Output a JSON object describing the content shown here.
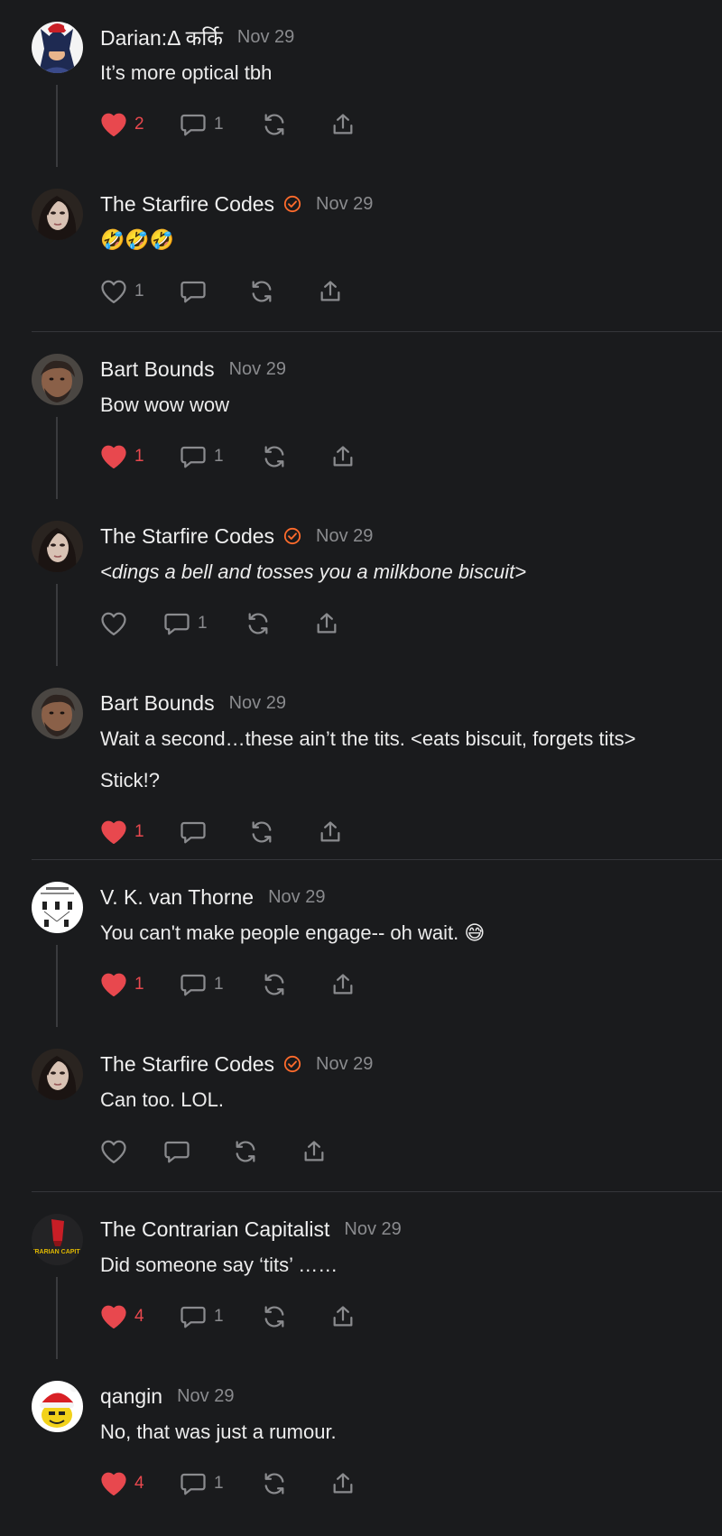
{
  "colors": {
    "background": "#1a1b1d",
    "liked": "#e8484e",
    "verified": "#ff6b2c",
    "muted": "#8a8b8e"
  },
  "comments": [
    {
      "author": "Darian:Δ कर्कि",
      "date": "Nov 29",
      "text": "It’s more optical tbh",
      "liked": true,
      "likes": "2",
      "replies": "1",
      "verified": false,
      "avatar": "batman-avatar"
    },
    {
      "author": "The Starfire Codes",
      "date": "Nov 29",
      "text": "🤣🤣🤣",
      "liked": false,
      "likes": "1",
      "replies": "",
      "verified": true,
      "avatar": "woman-portrait-avatar"
    },
    {
      "author": "Bart Bounds",
      "date": "Nov 29",
      "text": "Bow wow wow",
      "liked": true,
      "likes": "1",
      "replies": "1",
      "verified": false,
      "avatar": "caveman-avatar"
    },
    {
      "author": "The Starfire Codes",
      "date": "Nov 29",
      "text": "<dings a bell and tosses you a milkbone biscuit>",
      "liked": false,
      "likes": "",
      "replies": "1",
      "verified": true,
      "avatar": "woman-portrait-avatar"
    },
    {
      "author": "Bart Bounds",
      "date": "Nov 29",
      "text": "Wait a second…these ain’t the tits. <eats biscuit, forgets tits>",
      "text2": "Stick!?",
      "liked": true,
      "likes": "1",
      "replies": "",
      "verified": false,
      "avatar": "caveman-avatar"
    },
    {
      "author": "V. K. van Thorne",
      "date": "Nov 29",
      "text": "You can't make people engage-- oh wait. 😅",
      "liked": true,
      "likes": "1",
      "replies": "1",
      "verified": false,
      "avatar": "diagram-avatar"
    },
    {
      "author": "The Starfire Codes",
      "date": "Nov 29",
      "text": "Can too. LOL.",
      "liked": false,
      "likes": "",
      "replies": "",
      "verified": true,
      "avatar": "woman-portrait-avatar"
    },
    {
      "author": "The Contrarian Capitalist",
      "date": "Nov 29",
      "text": "Did someone say ‘tits’ ……",
      "liked": true,
      "likes": "4",
      "replies": "1",
      "verified": false,
      "avatar": "contrarian-capitalist-logo-avatar",
      "avatar_text": "CONTRARIAN CAPITALIST"
    },
    {
      "author": "qangin",
      "date": "Nov 29",
      "text": "No, that was just a rumour.",
      "liked": true,
      "likes": "4",
      "replies": "1",
      "verified": false,
      "avatar": "santa-hat-face-avatar"
    }
  ]
}
